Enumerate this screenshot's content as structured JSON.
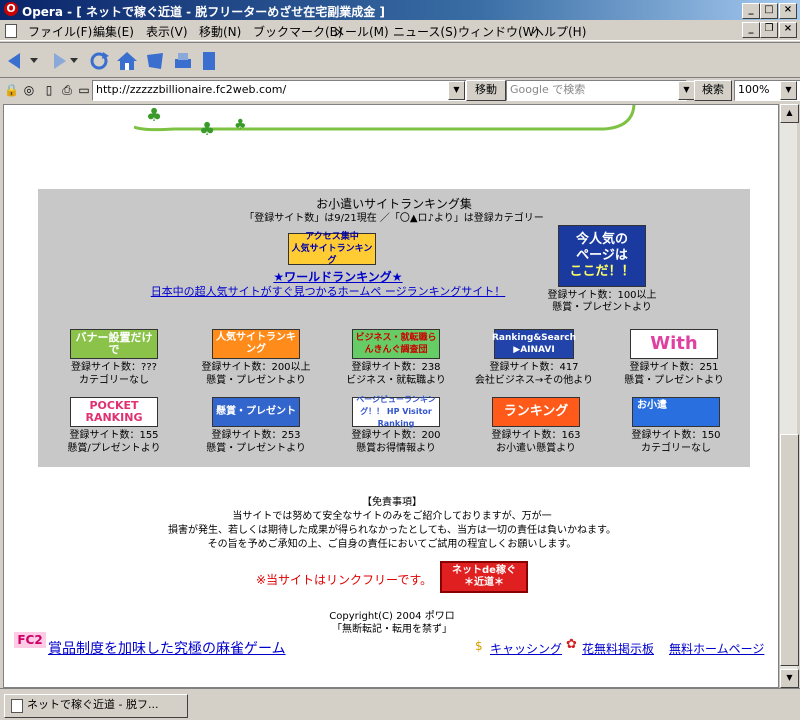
{
  "window": {
    "title": "Opera - [ ネットで稼ぐ近道 - 脱フリーターめざせ在宅副業成金 ]",
    "app_icon": "opera-logo-icon"
  },
  "menu": [
    "ファイル(F)",
    "編集(E)",
    "表示(V)",
    "移動(N)",
    "ブックマーク(B)",
    "メール(M)",
    "ニュース(S)",
    "ウィンドウ(W)",
    "ヘルプ(H)"
  ],
  "address": {
    "url": "http://zzzzzbillionaire.fc2web.com/",
    "go_label": "移動",
    "search_placeholder": "Google で検索",
    "search_label": "検索",
    "zoom": "100%"
  },
  "ranking": {
    "heading": "お小遣いサイトランキング集",
    "subheading": "「登録サイト数」は9/21現在 ／「〇▲ロ♪より」は登録カテゴリー",
    "featured": {
      "banner_line1": "アクセス集中",
      "banner_line2": "人気サイトランキング",
      "title": "★ワールドランキング★",
      "desc": "日本中の超人気サイトがすぐ見つかるホームペ ージランキングサイト！"
    },
    "popular": {
      "line1": "今人気の",
      "line2": "ページは",
      "line3": "ここだ！！",
      "count": "登録サイト数：100以上",
      "category": "懸賞・プレゼントより"
    },
    "row1": [
      {
        "banner": "バナー設置だけで",
        "count": "登録サイト数：???",
        "category": "カテゴリーなし",
        "color": "#8bc34a"
      },
      {
        "banner": "人気サイトランキング",
        "count": "登録サイト数：200以上",
        "category": "懸賞・プレゼントより",
        "color": "#ff8c1a"
      },
      {
        "banner": "ビジネス・就転職らんきんぐ調査団",
        "count": "登録サイト数：238",
        "category": "ビジネス・就転職より",
        "color": "#66cc66"
      },
      {
        "banner": "Ranking&Search ▶AINAVI",
        "count": "登録サイト数：417",
        "category": "会社ビジネス→その他より",
        "color": "#2244aa"
      },
      {
        "banner": "With",
        "count": "登録サイト数：251",
        "category": "懸賞・プレゼントより",
        "color": "#ffffff"
      }
    ],
    "row2": [
      {
        "banner": "POCKET RANKING",
        "count": "登録サイト数：155",
        "category": "懸賞/プレゼントより",
        "color": "#ffffff"
      },
      {
        "banner": "懸賞・プレゼント",
        "count": "登録サイト数：253",
        "category": "懸賞・プレゼントより",
        "color": "#3366cc"
      },
      {
        "banner": "ページビューランキング！！ HP Visitor Ranking",
        "count": "登録サイト数：200",
        "category": "懸賞お得情報より",
        "color": "#ffffff"
      },
      {
        "banner": "ランキング",
        "count": "登録サイト数：163",
        "category": "お小遣い懸賞より",
        "color": "#ff5a1a"
      },
      {
        "banner": "お小遣",
        "count": "登録サイト数：150",
        "category": "カテゴリーなし",
        "color": "#2a6fe0"
      }
    ]
  },
  "disclaimer": {
    "title": "【免責事項】",
    "lines": [
      "当サイトでは努めて安全なサイトのみをご紹介しておりますが、万が一",
      "損害が発生、若しくは期待した成果が得られなかったとしても、当方は一切の責任は負いかねます。",
      "その旨を予めご承知の上、ご自身の責任においてご試用の程宜しくお願いします。"
    ]
  },
  "linkfree": {
    "text": "※当サイトはリンクフリーです。",
    "banner_line1": "ネットde稼ぐ",
    "banner_line2": "＊近道＊"
  },
  "copyright": {
    "line1": "Copyright(C) 2004 ポワロ",
    "line2": "「無断転記・転用を禁ず」"
  },
  "fc2bar": {
    "logo": "FC2",
    "ad": "賞品制度を加味した究極の麻雀ゲーム",
    "links": [
      "キャッシング",
      "花無料掲示板",
      "無料ホームページ"
    ]
  },
  "status": {
    "tab_title": "ネットで稼ぐ近道 - 脱フ..."
  }
}
